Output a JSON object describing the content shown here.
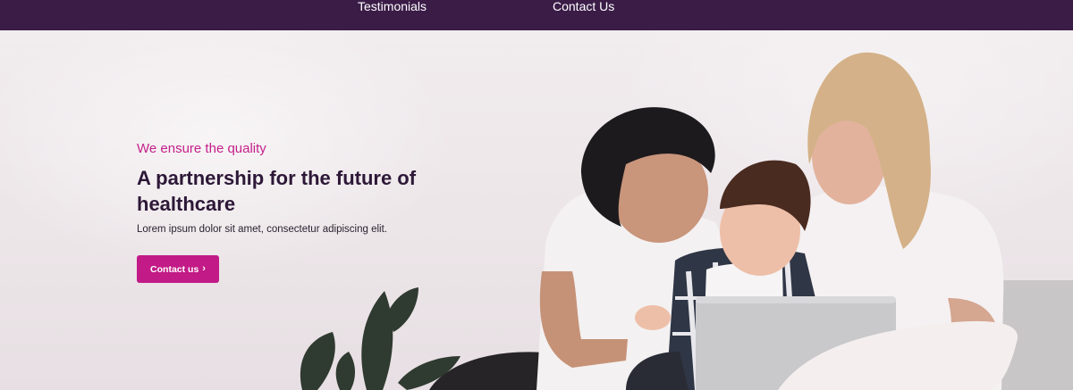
{
  "nav": {
    "items": [
      {
        "label": "Testimonials"
      },
      {
        "label": "Contact Us"
      }
    ]
  },
  "hero": {
    "kicker": "We ensure the quality",
    "headline": "A partnership for the future of healthcare",
    "subtext": "Lorem ipsum dolor sit amet, consectetur adipiscing elit.",
    "cta_label": "Contact us",
    "cta_icon": "chevron-right-icon"
  },
  "colors": {
    "nav_background": "#3a1c47",
    "accent": "#c21a86",
    "headline": "#2d1838"
  }
}
